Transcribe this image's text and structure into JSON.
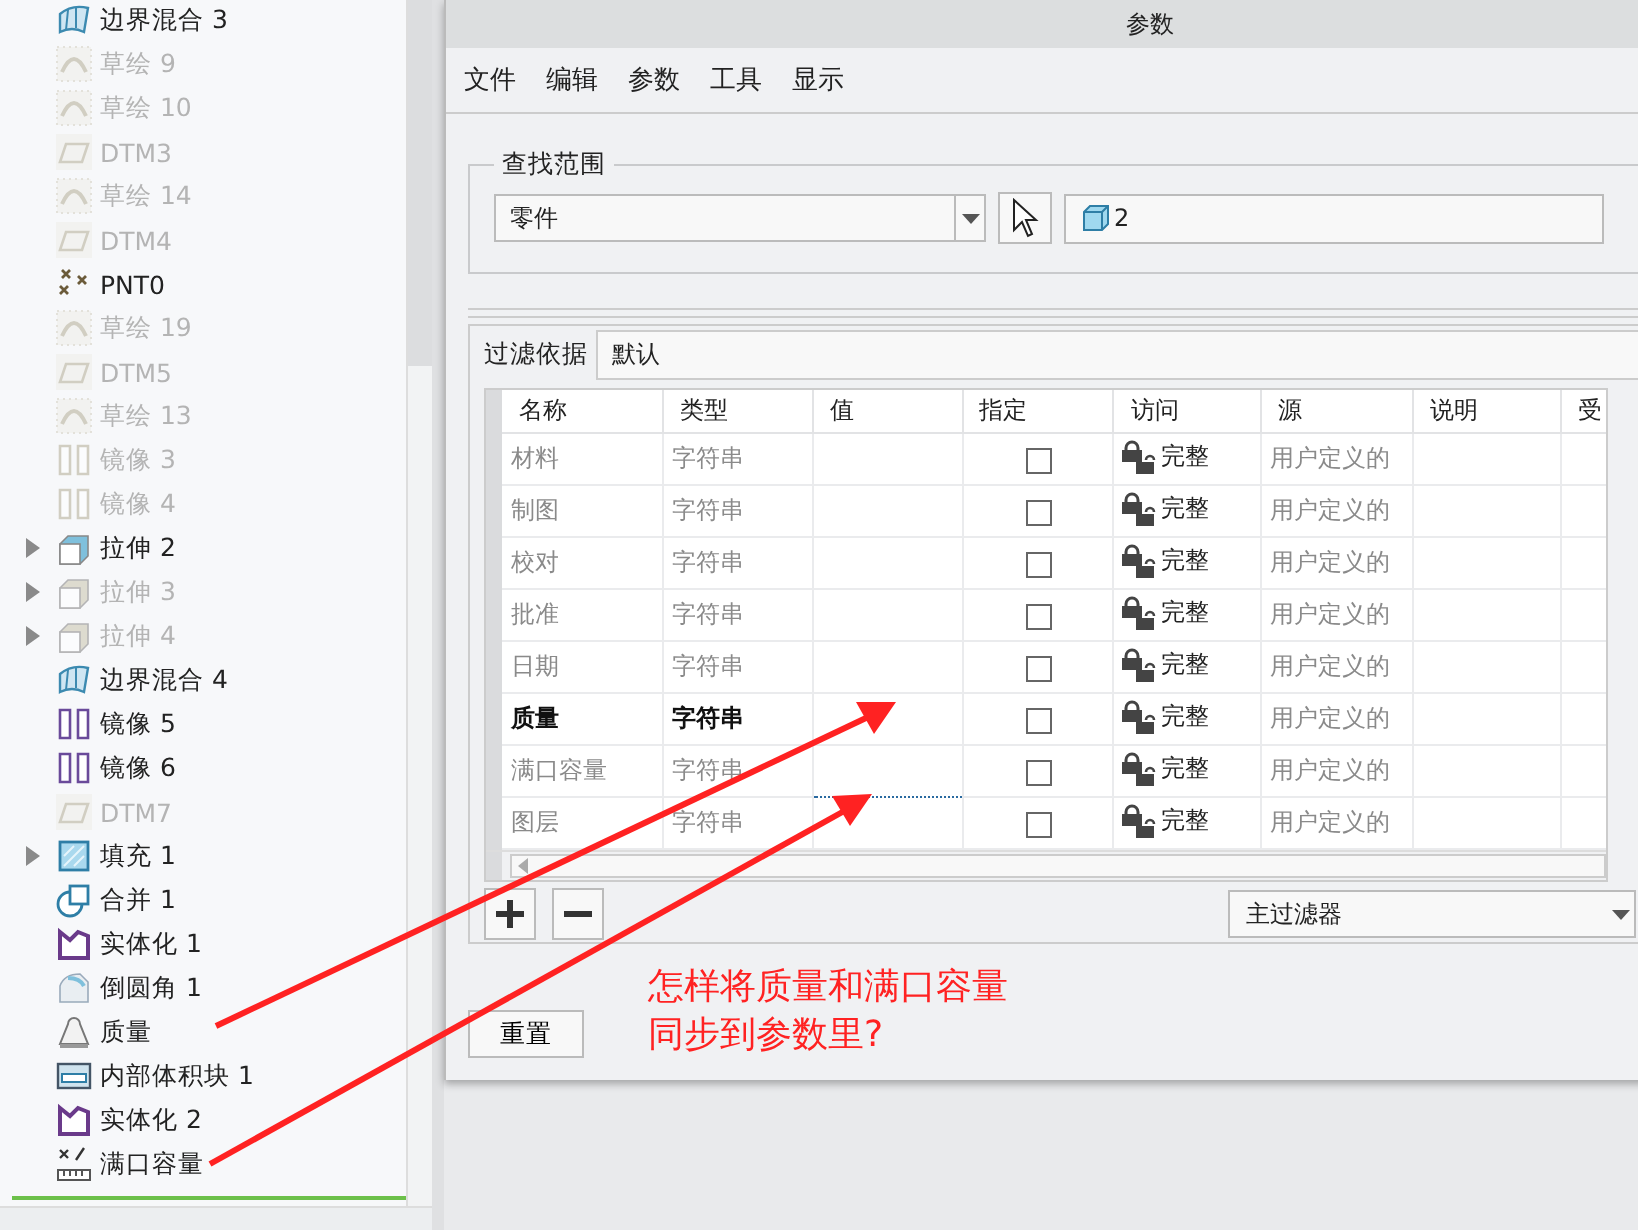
{
  "tree": {
    "items": [
      {
        "label": "边界混合 3",
        "kind": "boundary",
        "dimmed": false,
        "expander": false
      },
      {
        "label": "草绘 9",
        "kind": "sketch",
        "dimmed": true,
        "expander": false
      },
      {
        "label": "草绘 10",
        "kind": "sketch",
        "dimmed": true,
        "expander": false
      },
      {
        "label": "DTM3",
        "kind": "plane",
        "dimmed": true,
        "expander": false
      },
      {
        "label": "草绘 14",
        "kind": "sketch",
        "dimmed": true,
        "expander": false
      },
      {
        "label": "DTM4",
        "kind": "plane",
        "dimmed": true,
        "expander": false
      },
      {
        "label": "PNT0",
        "kind": "point",
        "dimmed": false,
        "expander": false
      },
      {
        "label": "草绘 19",
        "kind": "sketch",
        "dimmed": true,
        "expander": false
      },
      {
        "label": "DTM5",
        "kind": "plane",
        "dimmed": true,
        "expander": false
      },
      {
        "label": "草绘 13",
        "kind": "sketch",
        "dimmed": true,
        "expander": false
      },
      {
        "label": "镜像 3",
        "kind": "mirror",
        "dimmed": true,
        "expander": false
      },
      {
        "label": "镜像 4",
        "kind": "mirror",
        "dimmed": true,
        "expander": false
      },
      {
        "label": "拉伸 2",
        "kind": "extrude",
        "dimmed": false,
        "expander": true
      },
      {
        "label": "拉伸 3",
        "kind": "extrude",
        "dimmed": true,
        "expander": true
      },
      {
        "label": "拉伸 4",
        "kind": "extrude",
        "dimmed": true,
        "expander": true
      },
      {
        "label": "边界混合 4",
        "kind": "boundary",
        "dimmed": false,
        "expander": false
      },
      {
        "label": "镜像 5",
        "kind": "mirror",
        "dimmed": false,
        "expander": false
      },
      {
        "label": "镜像 6",
        "kind": "mirror",
        "dimmed": false,
        "expander": false
      },
      {
        "label": "DTM7",
        "kind": "plane",
        "dimmed": true,
        "expander": false
      },
      {
        "label": "填充 1",
        "kind": "fill",
        "dimmed": false,
        "expander": true
      },
      {
        "label": "合并 1",
        "kind": "merge",
        "dimmed": false,
        "expander": false
      },
      {
        "label": "实体化 1",
        "kind": "solidify",
        "dimmed": false,
        "expander": false
      },
      {
        "label": "倒圆角 1",
        "kind": "round",
        "dimmed": false,
        "expander": false
      },
      {
        "label": "质量",
        "kind": "mass",
        "dimmed": false,
        "expander": false
      },
      {
        "label": "内部体积块 1",
        "kind": "volume",
        "dimmed": false,
        "expander": false
      },
      {
        "label": "实体化 2",
        "kind": "solidify",
        "dimmed": false,
        "expander": false
      },
      {
        "label": "满口容量",
        "kind": "measure",
        "dimmed": false,
        "expander": false
      }
    ]
  },
  "dialog": {
    "title": "参数",
    "menu": [
      "文件",
      "编辑",
      "参数",
      "工具",
      "显示"
    ],
    "search_scope": {
      "legend": "查找范围",
      "scope_value": "零件",
      "model_value": "2"
    },
    "filter": {
      "label": "过滤依据",
      "value": "默认"
    },
    "table": {
      "columns": [
        "名称",
        "类型",
        "值",
        "指定",
        "访问",
        "源",
        "说明",
        "受"
      ],
      "rows": [
        {
          "name": "材料",
          "type": "字符串",
          "designated": false,
          "access": "完整",
          "source": "用户定义的",
          "emphasized": false,
          "focused": false
        },
        {
          "name": "制图",
          "type": "字符串",
          "designated": false,
          "access": "完整",
          "source": "用户定义的",
          "emphasized": false,
          "focused": false
        },
        {
          "name": "校对",
          "type": "字符串",
          "designated": false,
          "access": "完整",
          "source": "用户定义的",
          "emphasized": false,
          "focused": false
        },
        {
          "name": "批准",
          "type": "字符串",
          "designated": false,
          "access": "完整",
          "source": "用户定义的",
          "emphasized": false,
          "focused": false
        },
        {
          "name": "日期",
          "type": "字符串",
          "designated": false,
          "access": "完整",
          "source": "用户定义的",
          "emphasized": false,
          "focused": false
        },
        {
          "name": "质量",
          "type": "字符串",
          "designated": false,
          "access": "完整",
          "source": "用户定义的",
          "emphasized": true,
          "focused": false
        },
        {
          "name": "满口容量",
          "type": "字符串",
          "designated": false,
          "access": "完整",
          "source": "用户定义的",
          "emphasized": false,
          "focused": true
        },
        {
          "name": "图层",
          "type": "字符串",
          "designated": false,
          "access": "完整",
          "source": "用户定义的",
          "emphasized": false,
          "focused": false
        }
      ]
    },
    "filter_dropdown": "主过滤器",
    "reset_button": "重置"
  },
  "annotation": {
    "lines": [
      "怎样将质量和满口容量",
      "同步到参数里?"
    ]
  }
}
